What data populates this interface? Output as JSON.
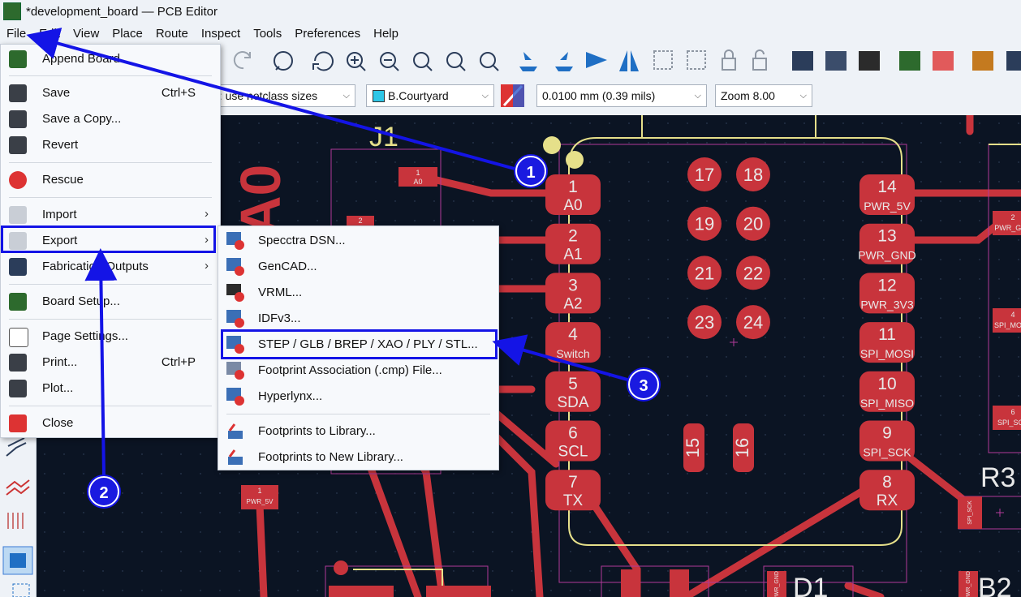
{
  "window": {
    "title": "*development_board — PCB Editor"
  },
  "menubar": [
    "File",
    "Edit",
    "View",
    "Place",
    "Route",
    "Inspect",
    "Tools",
    "Preferences",
    "Help"
  ],
  "toolbar2": {
    "track_width": "a: use netclass sizes",
    "layer": "B.Courtyard",
    "grid": "0.0100 mm (0.39 mils)",
    "zoom": "Zoom 8.00"
  },
  "file_menu": {
    "append_board": "Append Board",
    "save": "Save",
    "save_shortcut": "Ctrl+S",
    "save_copy": "Save a Copy...",
    "revert": "Revert",
    "rescue": "Rescue",
    "import": "Import",
    "export": "Export",
    "fabrication": "Fabrication Outputs",
    "board_setup": "Board Setup...",
    "page_settings": "Page Settings...",
    "print": "Print...",
    "print_shortcut": "Ctrl+P",
    "plot": "Plot...",
    "close": "Close"
  },
  "export_menu": {
    "specctra": "Specctra DSN...",
    "gencad": "GenCAD...",
    "vrml": "VRML...",
    "idf": "IDFv3...",
    "step": "STEP / GLB / BREP / XAO / PLY / STL...",
    "cmp": "Footprint Association (.cmp) File...",
    "hyperlynx": "Hyperlynx...",
    "fp_library": "Footprints to Library...",
    "fp_new_library": "Footprints to New Library..."
  },
  "annotations": {
    "badge1": "1",
    "badge2": "2",
    "badge3": "3"
  },
  "pcb": {
    "ref_j1": "J1",
    "ref_r3": "R3",
    "ref_d1": "D1",
    "ref_b2": "B2",
    "silk_large": "A0",
    "pads_left": [
      {
        "num": "1",
        "net": "A0"
      },
      {
        "num": "2",
        "net": "A1"
      },
      {
        "num": "3",
        "net": "A2"
      },
      {
        "num": "4",
        "net": "Switch"
      },
      {
        "num": "5",
        "net": "SDA"
      },
      {
        "num": "6",
        "net": "SCL"
      },
      {
        "num": "7",
        "net": "TX"
      }
    ],
    "pads_right": [
      {
        "num": "14",
        "net": "PWR_5V"
      },
      {
        "num": "13",
        "net": "PWR_GND"
      },
      {
        "num": "12",
        "net": "PWR_3V3"
      },
      {
        "num": "11",
        "net": "SPI_MOSI"
      },
      {
        "num": "10",
        "net": "SPI_MISO"
      },
      {
        "num": "9",
        "net": "SPI_SCK"
      },
      {
        "num": "8",
        "net": "RX"
      }
    ],
    "round_pads": [
      "17",
      "18",
      "19",
      "20",
      "21",
      "22",
      "23",
      "24"
    ],
    "vert_pads": [
      "15",
      "16"
    ],
    "small_pad_j1": {
      "num": "1",
      "net": "A0"
    },
    "small_pad_pwr": {
      "num": "1",
      "net": "PWR_5V"
    },
    "small_pad_2": "2",
    "small_pad_spi": "SPI_SCK",
    "edge_pwr_gn": "PWR_GN",
    "edge_spi_mos": "SPI_MOS",
    "edge_spi_sc": "SPI_SC",
    "edge_gnd": "PWR_GND",
    "edge_2": "2",
    "edge_4": "4",
    "edge_6": "6"
  }
}
